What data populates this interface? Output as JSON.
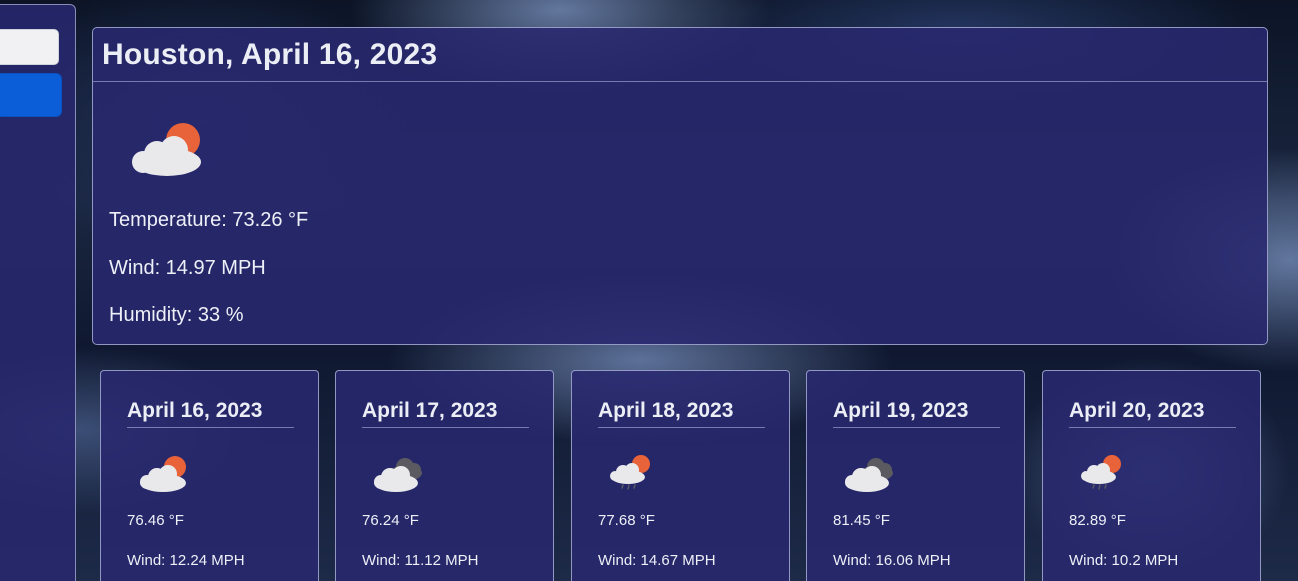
{
  "sidebar": {
    "search_placeholder": "",
    "search_value": "",
    "search_button_label": ""
  },
  "current": {
    "title": "Houston, April 16, 2023",
    "icon": "partly-cloudy-day-icon",
    "temperature": "Temperature: 73.26 °F",
    "wind": "Wind: 14.97 MPH",
    "humidity": "Humidity: 33 %"
  },
  "forecast": [
    {
      "date": "April 16, 2023",
      "icon": "partly-cloudy-day-icon",
      "temp": "76.46 °F",
      "wind": "Wind: 12.24 MPH"
    },
    {
      "date": "April 17, 2023",
      "icon": "overcast-clouds-icon",
      "temp": "76.24 °F",
      "wind": "Wind: 11.12 MPH"
    },
    {
      "date": "April 18, 2023",
      "icon": "light-rain-icon",
      "temp": "77.68 °F",
      "wind": "Wind: 14.67 MPH"
    },
    {
      "date": "April 19, 2023",
      "icon": "overcast-clouds-icon",
      "temp": "81.45 °F",
      "wind": "Wind: 16.06 MPH"
    },
    {
      "date": "April 20, 2023",
      "icon": "light-rain-icon",
      "temp": "82.89 °F",
      "wind": "Wind: 10.2 MPH"
    }
  ],
  "colors": {
    "card_background": "#28286e",
    "sun": "#e8623a",
    "cloud_light": "#e9e9ec",
    "cloud_dark": "#5a5a60",
    "button_primary": "#0b5ed7"
  }
}
